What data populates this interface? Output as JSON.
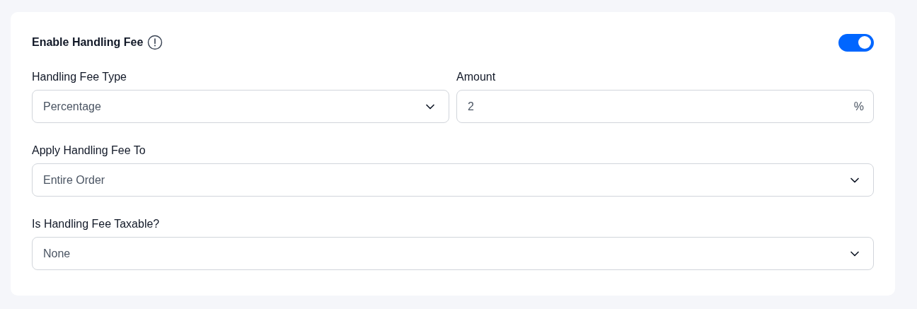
{
  "header": {
    "title": "Enable Handling Fee",
    "toggle": {
      "on": true
    }
  },
  "rows": [
    {
      "fields": [
        {
          "kind": "select",
          "label": "Handling Fee Type",
          "value": "Percentage"
        },
        {
          "kind": "input",
          "label": "Amount",
          "value": "2",
          "suffix": "%"
        }
      ]
    },
    {
      "fields": [
        {
          "kind": "select",
          "label": "Apply Handling Fee To",
          "value": "Entire Order"
        }
      ]
    },
    {
      "fields": [
        {
          "kind": "select",
          "label": "Is Handling Fee Taxable?",
          "value": "None"
        }
      ]
    }
  ]
}
